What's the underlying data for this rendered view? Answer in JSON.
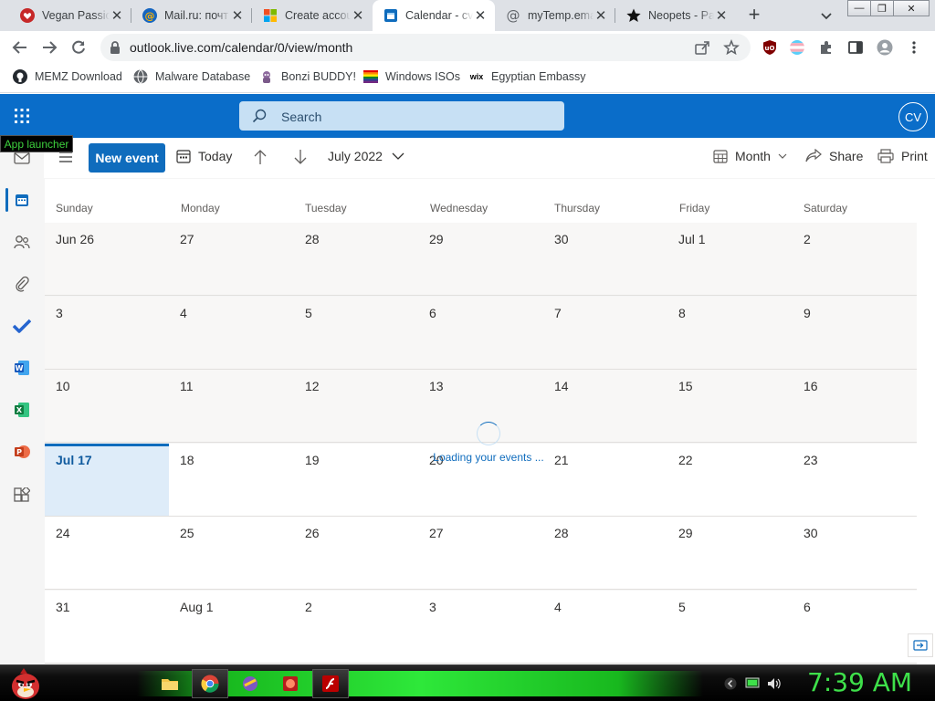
{
  "browser": {
    "tabs": [
      {
        "title": "Vegan Passio",
        "icon": "heart-icon"
      },
      {
        "title": "Mail.ru: почт",
        "icon": "at-sign-icon"
      },
      {
        "title": "Create accou",
        "icon": "microsoft-icon"
      },
      {
        "title": "Calendar - cv",
        "icon": "outlook-calendar-icon"
      },
      {
        "title": "myTemp.ema",
        "icon": "at-sign-icon"
      },
      {
        "title": "Neopets - Pa",
        "icon": "star-icon"
      }
    ],
    "new_tab": "+",
    "url": "outlook.live.com/calendar/0/view/month"
  },
  "bookmarks": [
    {
      "label": "MEMZ Download",
      "icon": "github-icon"
    },
    {
      "label": "Malware Database",
      "icon": "globe-icon"
    },
    {
      "label": "Bonzi BUDDY!",
      "icon": "bonzi-icon"
    },
    {
      "label": "Windows ISOs",
      "icon": "rainbow-flag-icon"
    },
    {
      "label": "Egyptian Embassy",
      "icon": "wix-icon"
    }
  ],
  "outlook": {
    "search_placeholder": "Search",
    "avatar_initials": "CV",
    "tooltip": "App launcher",
    "new_event": "New event",
    "today": "Today",
    "current_period": "July 2022",
    "view": "Month",
    "share": "Share",
    "print": "Print",
    "loading": "Loading your events ..."
  },
  "calendar": {
    "weekdays": [
      "Sunday",
      "Monday",
      "Tuesday",
      "Wednesday",
      "Thursday",
      "Friday",
      "Saturday"
    ],
    "weeks": [
      [
        "Jun 26",
        "27",
        "28",
        "29",
        "30",
        "Jul 1",
        "2"
      ],
      [
        "3",
        "4",
        "5",
        "6",
        "7",
        "8",
        "9"
      ],
      [
        "10",
        "11",
        "12",
        "13",
        "14",
        "15",
        "16"
      ],
      [
        "Jul 17",
        "18",
        "19",
        "20",
        "21",
        "22",
        "23"
      ],
      [
        "24",
        "25",
        "26",
        "27",
        "28",
        "29",
        "30"
      ],
      [
        "31",
        "Aug 1",
        "2",
        "3",
        "4",
        "5",
        "6"
      ]
    ],
    "today_week": 3,
    "today_day": 0
  },
  "taskbar": {
    "clock": "7:39 AM"
  },
  "colors": {
    "outlook_blue": "#0f6cbd",
    "header_blue": "#0a6dc9",
    "today_bg": "#deecf9",
    "taskbar_green": "#2ee83a"
  }
}
